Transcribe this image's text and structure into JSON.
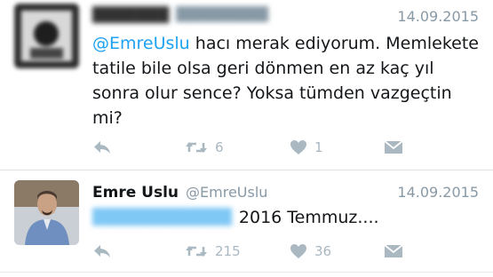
{
  "tweets": [
    {
      "display_name": "",
      "handle": "",
      "date": "14.09.2015",
      "mention": "@EmreUslu",
      "text": " hacı merak ediyorum. Memlekete tatile bile olsa geri dönmen en az kaç yıl sonra olur sence? Yoksa tümden vazgeçtin mi?",
      "retweets": "6",
      "likes": "1"
    },
    {
      "display_name": "Emre Uslu",
      "handle": "@EmreUslu",
      "date": "14.09.2015",
      "mention": "",
      "text": "2016 Temmuz....",
      "retweets": "215",
      "likes": "36"
    }
  ],
  "colors": {
    "link": "#1da1f2",
    "icon": "#aab8c2",
    "secondary_text": "#8899a6"
  },
  "icons": [
    "reply-icon",
    "retweet-icon",
    "like-icon",
    "direct-message-icon"
  ]
}
